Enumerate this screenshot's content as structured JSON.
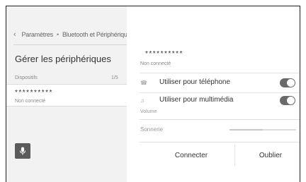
{
  "breadcrumb": {
    "back_icon": "chevron-left-icon",
    "parent": "Paramètres",
    "separator": "•",
    "current": "Bluetooth et Périphériques"
  },
  "left": {
    "title": "Gérer les périphériques",
    "devices_label": "Dispositifs",
    "devices_count": "1/5",
    "devices": [
      {
        "name": "**********",
        "status": "Non connecté"
      }
    ],
    "mic_icon": "microphone-icon"
  },
  "detail": {
    "device_name": "**********",
    "device_status": "Non connecté",
    "options": [
      {
        "icon": "phone-icon",
        "label": "Utiliser pour téléphone",
        "enabled": true
      },
      {
        "icon": "music-note-icon",
        "label": "Utiliser pour multimédia",
        "enabled": true
      }
    ],
    "volume_label": "Volume",
    "ringtone_label": "Sonnerie",
    "ringtone_level": 0.5,
    "connect_label": "Connecter",
    "forget_label": "Oublier"
  },
  "colors": {
    "left_pane_bg": "#f2f2f2",
    "toggle_on": "#6a6a6a",
    "mic_button": "#5b5b5b"
  }
}
